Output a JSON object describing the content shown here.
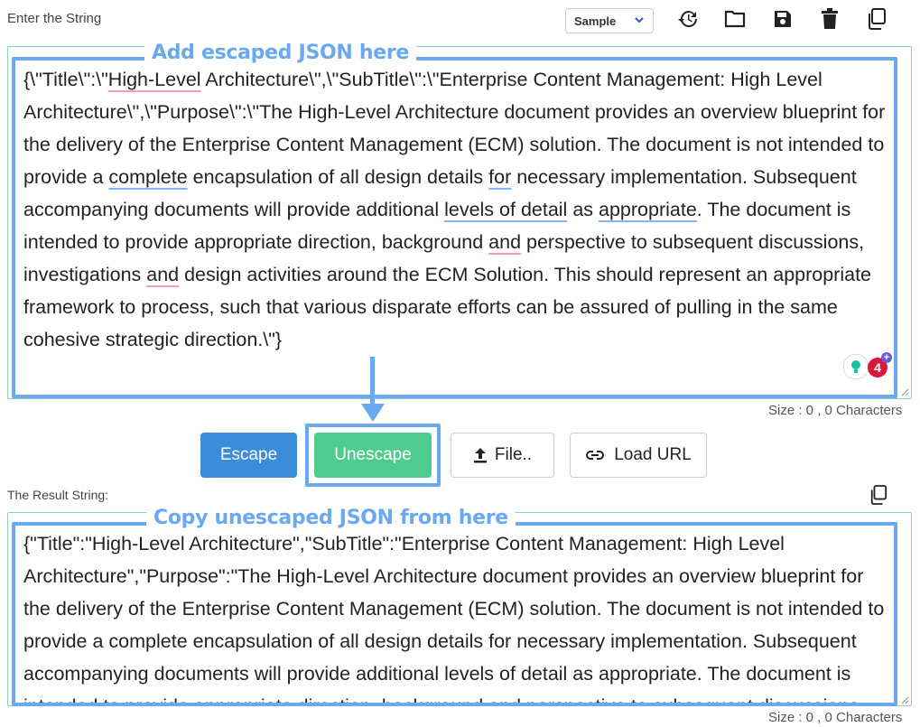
{
  "input_section": {
    "label": "Enter the String",
    "sample_select": "Sample",
    "annotation": "Add escaped JSON here",
    "text_parts": [
      "{\\\"Title\\\":\\\"",
      "High-Level",
      " Architecture\\\",\\\"SubTitle\\\":\\\"Enterprise Content Management: High Level Architecture\\\",\\\"Purpose\\\":\\\"The High-Level Architecture document provides an overview blueprint for the delivery of the Enterprise Content Management (ECM) solution. The document is not intended to provide a ",
      "complete",
      " encapsulation of all design details ",
      "for",
      " necessary implementation. Subsequent accompanying documents will provide additional ",
      "levels of detail",
      " as ",
      "appropriate",
      ". The document is intended to provide appropriate direction, background ",
      "and",
      " perspective to subsequent discussions, investigations ",
      "and",
      " design activities around the ECM Solution. This should represent an appropriate framework to process, such that various disparate efforts can be assured of pulling in the same cohesive strategic direction.\\\"}"
    ],
    "size_text": "Size : 0 , 0 Characters",
    "badge_count": "4"
  },
  "buttons": {
    "escape": "Escape",
    "unescape": "Unescape",
    "file": "File..",
    "load_url": "Load URL"
  },
  "result_section": {
    "label": "The Result String:",
    "annotation": "Copy unescaped JSON from here",
    "text": "{\"Title\":\"High-Level Architecture\",\"SubTitle\":\"Enterprise Content Management: High Level Architecture\",\"Purpose\":\"The High-Level Architecture document provides an overview blueprint for the delivery of the Enterprise Content Management (ECM) solution. The document is not intended to provide a complete encapsulation of all design details for necessary implementation. Subsequent accompanying documents will provide additional levels of detail as appropriate. The document is intended to provide appropriate direction, background and perspective to subsequent discussions, investigations and design activities around the ECM Solution.",
    "size_text": "Size : 0 , 0 Characters"
  },
  "icons": {
    "toolbar": [
      "history-icon",
      "folder-icon",
      "save-icon",
      "trash-icon",
      "copy-icon"
    ],
    "result_copy": "copy-icon"
  },
  "colors": {
    "annotation_blue": "#6aa8f0",
    "escape_button": "#3c8dd9",
    "unescape_button": "#4ecb8e",
    "textarea_border": "#8fd0b8",
    "badge_red": "#d9183b"
  }
}
